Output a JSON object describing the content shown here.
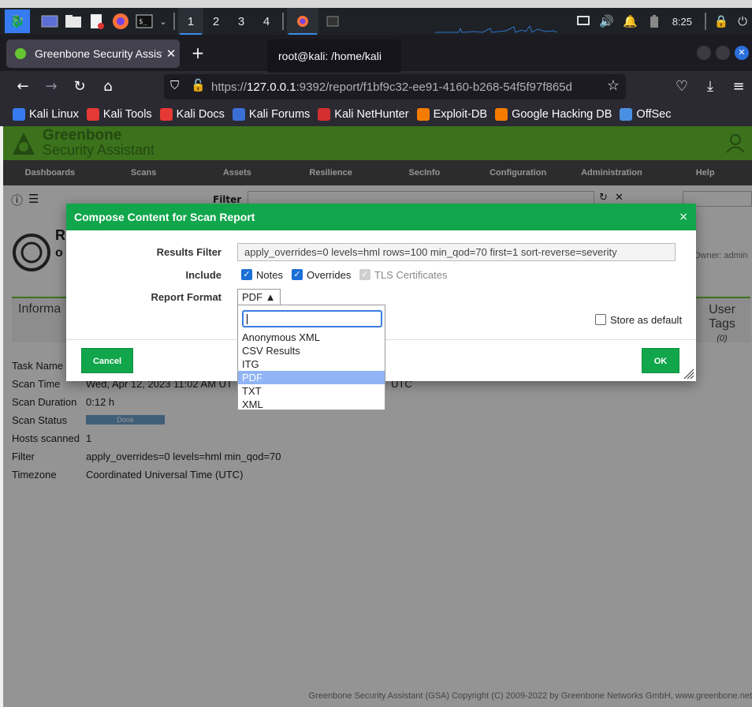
{
  "taskbar": {
    "workspaces": [
      "1",
      "2",
      "3",
      "4"
    ],
    "clock": "8:25"
  },
  "browser": {
    "tab_title": "Greenbone Security Assistant",
    "tab_close": "✕",
    "new_tab": "+",
    "tooltip": "root@kali: /home/kali",
    "url_dim_prefix": "https://",
    "url_host": "127.0.0.1",
    "url_rest": ":9392/report/f1bf9c32-ee91-4160-b268-54f5f97f865d",
    "bookmarks": [
      {
        "label": "Kali Linux",
        "color": "#367bf0"
      },
      {
        "label": "Kali Tools",
        "color": "#e53935"
      },
      {
        "label": "Kali Docs",
        "color": "#e53935"
      },
      {
        "label": "Kali Forums",
        "color": "#3b6fd6"
      },
      {
        "label": "Kali NetHunter",
        "color": "#d32f2f"
      },
      {
        "label": "Exploit-DB",
        "color": "#f57c00"
      },
      {
        "label": "Google Hacking DB",
        "color": "#f57c00"
      },
      {
        "label": "OffSec",
        "color": "#4a90e2"
      }
    ]
  },
  "gsa": {
    "logo_line1": "Greenbone",
    "logo_line2": "Security Assistant",
    "menu": [
      "Dashboards",
      "Scans",
      "Assets",
      "Resilience",
      "SecInfo",
      "Configuration",
      "Administration",
      "Help"
    ],
    "toolbar_filter_label": "Filter",
    "report_title_char": "R",
    "report_sub_char": "o",
    "owner": "Owner: admin",
    "info_tab": "Informa",
    "user_tags_label_1": "User",
    "user_tags_label_2": "Tags",
    "user_tags_count": "(0)",
    "details": [
      {
        "label": "Task Name",
        "value": ""
      },
      {
        "label": "Scan Time",
        "value": "Wed, Apr 12, 2023 11:02 AM UT"
      },
      {
        "label": "Scan Duration",
        "value": "0:12 h"
      },
      {
        "label": "Scan Status",
        "value": "Done"
      },
      {
        "label": "Hosts scanned",
        "value": "1"
      },
      {
        "label": "Filter",
        "value": "apply_overrides=0 levels=hml min_qod=70"
      },
      {
        "label": "Timezone",
        "value": "Coordinated Universal Time (UTC)"
      }
    ],
    "scan_time_suffix": "UTC",
    "footer": "Greenbone Security Assistant (GSA) Copyright (C) 2009-2022 by Greenbone Networks GmbH, www.greenbone.net"
  },
  "dialog": {
    "title": "Compose Content for Scan Report",
    "close": "×",
    "results_filter_label": "Results Filter",
    "results_filter_value": "apply_overrides=0 levels=hml rows=100 min_qod=70 first=1 sort-reverse=severity",
    "include_label": "Include",
    "include_options": [
      {
        "label": "Notes",
        "checked": true,
        "disabled": false
      },
      {
        "label": "Overrides",
        "checked": true,
        "disabled": false
      },
      {
        "label": "TLS Certificates",
        "checked": true,
        "disabled": true
      }
    ],
    "report_format_label": "Report Format",
    "report_format_value": "PDF ▲",
    "store_default_label": "Store as default",
    "cancel_label": "Cancel",
    "ok_label": "OK",
    "format_options": [
      "Anonymous XML",
      "CSV Results",
      "ITG",
      "PDF",
      "TXT",
      "XML"
    ],
    "format_selected": "PDF",
    "search_value": ""
  },
  "colors": {
    "gsa_green": "#66c430",
    "dialog_green": "#11a64b",
    "menu_gray": "#4c4c4c",
    "taskbar": "#1e2126",
    "select_blue": "#90b4f5"
  }
}
